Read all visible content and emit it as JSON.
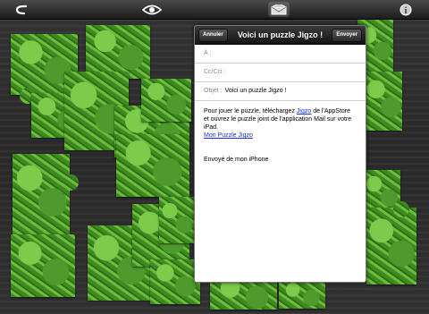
{
  "toolbar": {
    "back_icon": "back-arrow-icon",
    "eye_icon": "eye-icon",
    "mail_icon": "mail-envelope-icon",
    "info_icon": "info-icon"
  },
  "mail": {
    "cancel_label": "Annuler",
    "title": "Voici un puzzle Jigzo !",
    "send_label": "Envoyer",
    "to_label": "À :",
    "to_value": "",
    "cc_label": "Cc/Cci :",
    "cc_value": "",
    "subject_label": "Objet :",
    "subject_value": "Voici un puzzle Jigzo !",
    "body_before_link": "Pour jouer le puzzle, téléchargez ",
    "body_link": "Jigzo",
    "body_after_link": " de l'AppStore et ouvrez le puzzle joint de l'application Mail sur votre iPad.",
    "puzzle_link": "Mon Puzzle Jigzo",
    "signature": "Envoyé de mon iPhone"
  },
  "colors": {
    "link": "#1a2fcf",
    "leaf_green": "#4e9a2c"
  }
}
